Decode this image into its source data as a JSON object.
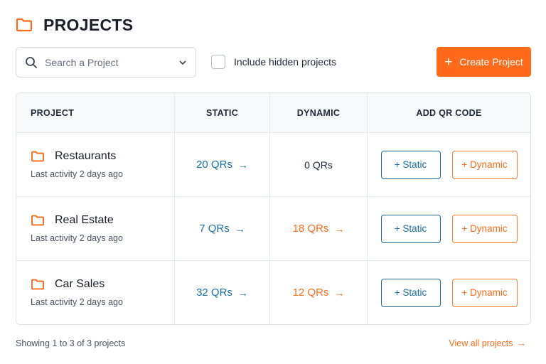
{
  "page": {
    "title": "PROJECTS",
    "icon": "folder-icon",
    "accent_color": "#ff6b1a",
    "link_color": "#1c6ea4"
  },
  "toolbar": {
    "search_placeholder": "Search a Project",
    "hidden_label": "Include hidden projects",
    "hidden_checked": false,
    "create_label": "Create Project"
  },
  "table": {
    "headers": {
      "project": "PROJECT",
      "static": "STATIC",
      "dynamic": "DYNAMIC",
      "add": "ADD QR CODE"
    },
    "rows": [
      {
        "name": "Restaurants",
        "activity": "Last activity 2 days ago",
        "static": "20 QRs",
        "dynamic": "0 QRs",
        "dynamic_is_link": false,
        "btn_static": "+ Static",
        "btn_dynamic": "+ Dynamic"
      },
      {
        "name": "Real Estate",
        "activity": "Last activity 2 days ago",
        "static": "7 QRs",
        "dynamic": "18 QRs",
        "dynamic_is_link": true,
        "btn_static": "+ Static",
        "btn_dynamic": "+ Dynamic"
      },
      {
        "name": "Car Sales",
        "activity": "Last activity 2 days ago",
        "static": "32 QRs",
        "dynamic": "12 QRs",
        "dynamic_is_link": true,
        "btn_static": "+ Static",
        "btn_dynamic": "+ Dynamic"
      }
    ]
  },
  "footer": {
    "showing": "Showing 1 to 3 of 3 projects",
    "view_all": "View all projects"
  }
}
